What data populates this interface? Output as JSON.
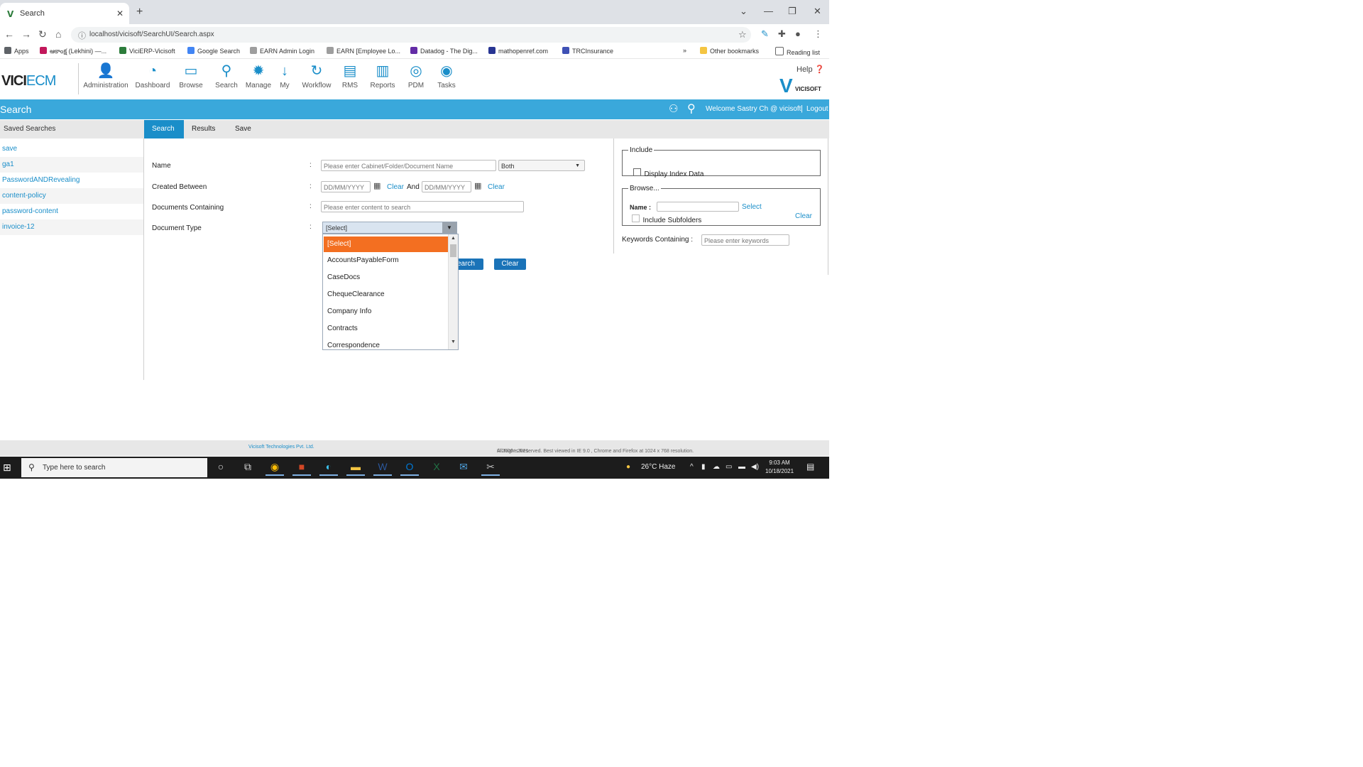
{
  "browser": {
    "tab_title": "Search",
    "url": "localhost/vicisoft/SearchUI/Search.aspx",
    "bookmarks": [
      "Apps",
      "ఆకాంక్ష (Lekhini) —...",
      "ViciERP-Vicisoft",
      "Google Search",
      "EARN Admin Login",
      "EARN [Employee Lo...",
      "Datadog - The Dig...",
      "mathopenref.com",
      "TRCInsurance"
    ],
    "other_bookmarks": "Other bookmarks",
    "reading_list": "Reading list"
  },
  "app": {
    "logo_main": "VICI",
    "logo_accent": "ECM",
    "nav": [
      {
        "label": "Administration",
        "icon": "administration-icon"
      },
      {
        "label": "Dashboard",
        "icon": "dashboard-icon"
      },
      {
        "label": "Browse",
        "icon": "browse-icon"
      },
      {
        "label": "Search",
        "icon": "search-icon"
      },
      {
        "label": "Manage",
        "icon": "manage-icon"
      },
      {
        "label": "My",
        "icon": "my-icon"
      },
      {
        "label": "Workflow",
        "icon": "workflow-icon"
      },
      {
        "label": "RMS",
        "icon": "rms-icon"
      },
      {
        "label": "Reports",
        "icon": "reports-icon"
      },
      {
        "label": "PDM",
        "icon": "pdm-icon"
      },
      {
        "label": "Tasks",
        "icon": "tasks-icon"
      }
    ],
    "help": "Help",
    "brand": "VICISOFT",
    "page_title": "Search",
    "welcome": "Welcome Sastry Ch @ vicisoft",
    "logout": "Logout"
  },
  "saved_searches": {
    "header": "Saved Searches",
    "items": [
      "save",
      "ga1",
      "PasswordANDRevealing",
      "content-policy",
      "password-content",
      "invoice-12"
    ]
  },
  "form_tabs": [
    "Search",
    "Results",
    "Save"
  ],
  "form": {
    "name_label": "Name",
    "name_placeholder": "Please enter Cabinet/Folder/Document Name",
    "name_scope": "Both",
    "created_label": "Created Between",
    "date_placeholder": "DD/MM/YYYY",
    "clear": "Clear",
    "and": "And",
    "docs_label": "Documents Containing",
    "docs_placeholder": "Please enter content to search",
    "doctype_label": "Document Type",
    "doctype_value": "[Select]",
    "doctype_options": [
      "[Select]",
      "AccountsPayableForm",
      "CaseDocs",
      "ChequeClearance",
      "Company Info",
      "Contracts",
      "Correspondence"
    ],
    "search_button": "Search",
    "clear_button": "Clear"
  },
  "right": {
    "include_legend": "Include",
    "display_index": "Display Index Data",
    "browse_legend": "Browse...",
    "name_label": "Name :",
    "select_link": "Select",
    "clear_link": "Clear",
    "include_subfolders": "Include Subfolders",
    "keywords_label": "Keywords Containing :",
    "keywords_placeholder": "Please enter keywords"
  },
  "footer": {
    "prefix": "© 2006 - 2021",
    "company": "Vicisoft Technologies Pvt. Ltd.",
    "suffix": "All Rights Reserved. Best viewed in IE 9.0 , Chrome and Firefox at 1024 x 768 resolution."
  },
  "taskbar": {
    "search_placeholder": "Type here to search",
    "weather": "26°C Haze",
    "time": "9:03 AM",
    "date": "10/18/2021"
  },
  "colors": {
    "accent_blue": "#3aa8db",
    "link_blue": "#1a8ec9",
    "selected_orange": "#f36f21"
  }
}
